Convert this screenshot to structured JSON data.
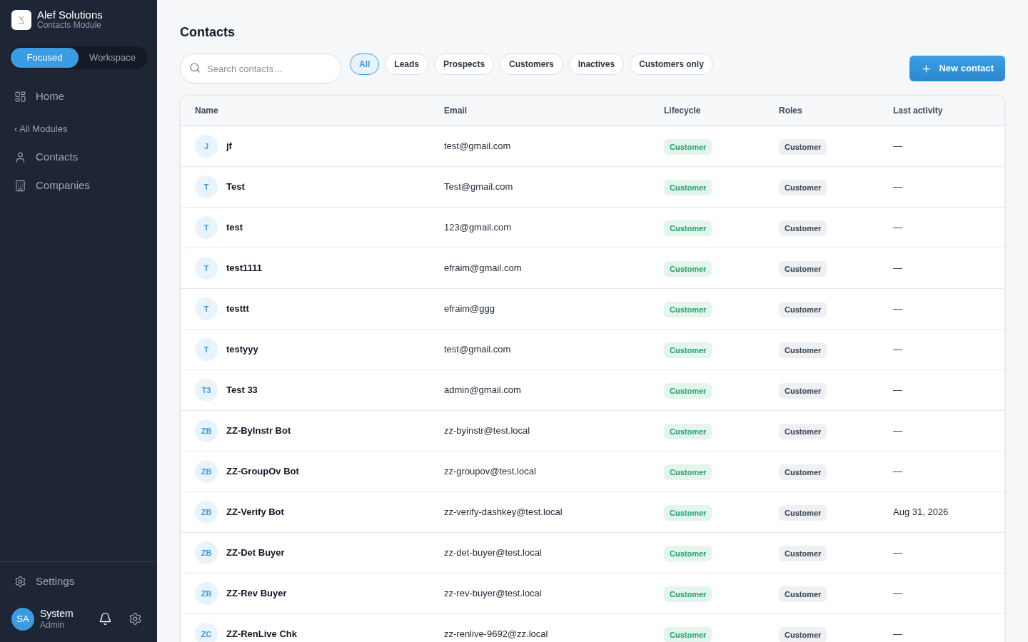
{
  "sidebar": {
    "brand": {
      "title": "Alef Solutions",
      "subtitle": "Contacts Module"
    },
    "modes": [
      {
        "label": "Focused",
        "selected": true
      },
      {
        "label": "Workspace",
        "selected": false
      }
    ],
    "nav": [
      {
        "label": "Home",
        "kind": "home"
      }
    ],
    "back_link": "‹ All Modules",
    "module_nav": [
      {
        "label": "Contacts",
        "kind": "contacts"
      },
      {
        "label": "Companies",
        "kind": "companies"
      }
    ],
    "settings": {
      "label": "Settings",
      "kind": "settings"
    },
    "user": {
      "initials": "SA",
      "name": "System",
      "role": "Admin"
    }
  },
  "main": {
    "title": "Contacts",
    "search": {
      "placeholder": "Search contacts…"
    },
    "filters": [
      {
        "label": "All",
        "selected": true
      },
      {
        "label": "Leads",
        "selected": false
      },
      {
        "label": "Prospects",
        "selected": false
      },
      {
        "label": "Customers",
        "selected": false
      },
      {
        "label": "Inactives",
        "selected": false
      },
      {
        "label": "Customers only",
        "selected": false
      }
    ],
    "new_button": "New contact",
    "table": {
      "columns": [
        "Name",
        "Email",
        "Lifecycle",
        "Roles",
        "Last activity"
      ],
      "rows": [
        {
          "initials": "J",
          "name": "jf",
          "email": "test@gmail.com",
          "lifecycle": "Customer",
          "roles": "Customer",
          "last_activity": "—"
        },
        {
          "initials": "T",
          "name": "Test",
          "email": "Test@gmail.com",
          "lifecycle": "Customer",
          "roles": "Customer",
          "last_activity": "—"
        },
        {
          "initials": "T",
          "name": "test",
          "email": "123@gmail.com",
          "lifecycle": "Customer",
          "roles": "Customer",
          "last_activity": "—"
        },
        {
          "initials": "T",
          "name": "test1111",
          "email": "efraim@gmail.com",
          "lifecycle": "Customer",
          "roles": "Customer",
          "last_activity": "—"
        },
        {
          "initials": "T",
          "name": "testtt",
          "email": "efraim@ggg",
          "lifecycle": "Customer",
          "roles": "Customer",
          "last_activity": "—"
        },
        {
          "initials": "T",
          "name": "testyyy",
          "email": "test@gmail.com",
          "lifecycle": "Customer",
          "roles": "Customer",
          "last_activity": "—"
        },
        {
          "initials": "T3",
          "name": "Test 33",
          "email": "admin@gmail.com",
          "lifecycle": "Customer",
          "roles": "Customer",
          "last_activity": "—"
        },
        {
          "initials": "ZB",
          "name": "ZZ-ByInstr Bot",
          "email": "zz-byinstr@test.local",
          "lifecycle": "Customer",
          "roles": "Customer",
          "last_activity": "—"
        },
        {
          "initials": "ZB",
          "name": "ZZ-GroupOv Bot",
          "email": "zz-groupov@test.local",
          "lifecycle": "Customer",
          "roles": "Customer",
          "last_activity": "—"
        },
        {
          "initials": "ZB",
          "name": "ZZ-Verify Bot",
          "email": "zz-verify-dashkey@test.local",
          "lifecycle": "Customer",
          "roles": "Customer",
          "last_activity": "Aug 31, 2026"
        },
        {
          "initials": "ZB",
          "name": "ZZ-Det Buyer",
          "email": "zz-det-buyer@test.local",
          "lifecycle": "Customer",
          "roles": "Customer",
          "last_activity": "—"
        },
        {
          "initials": "ZB",
          "name": "ZZ-Rev Buyer",
          "email": "zz-rev-buyer@test.local",
          "lifecycle": "Customer",
          "roles": "Customer",
          "last_activity": "—"
        },
        {
          "initials": "ZC",
          "name": "ZZ-RenLive Chk",
          "email": "zz-renlive-9692@zz.local",
          "lifecycle": "Customer",
          "roles": "Customer",
          "last_activity": "—"
        }
      ]
    }
  }
}
